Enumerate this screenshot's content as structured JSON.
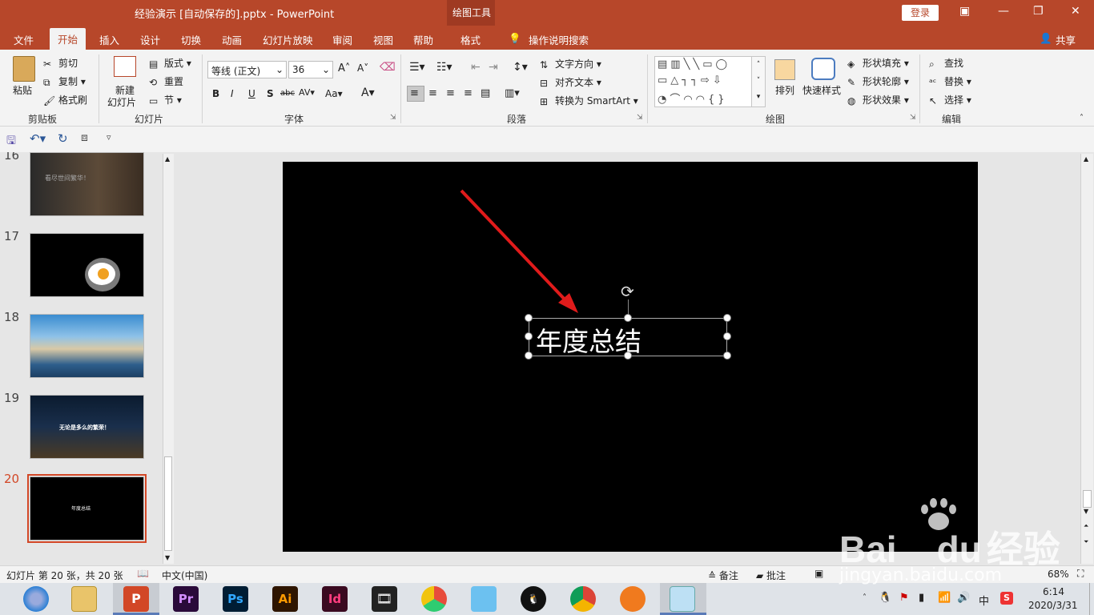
{
  "window": {
    "title": "经验演示 [自动保存的].pptx  -  PowerPoint",
    "context_tab": "绘图工具",
    "login": "登录"
  },
  "tabs": [
    "文件",
    "开始",
    "插入",
    "设计",
    "切换",
    "动画",
    "幻灯片放映",
    "审阅",
    "视图",
    "帮助",
    "格式"
  ],
  "tell_me": "操作说明搜索",
  "share": "共享",
  "ribbon": {
    "clipboard": {
      "paste": "粘贴",
      "cut": "剪切",
      "copy": "复制",
      "format_painter": "格式刷",
      "label": "剪贴板"
    },
    "slides": {
      "new_slide_1": "新建",
      "new_slide_2": "幻灯片",
      "layout": "版式",
      "reset": "重置",
      "section": "节",
      "label": "幻灯片"
    },
    "font": {
      "name": "等线 (正文)",
      "size": "36",
      "bold": "B",
      "italic": "I",
      "underline": "U",
      "shadow": "S",
      "strike": "abc",
      "spacing": "AV",
      "case": "Aa",
      "label": "字体"
    },
    "paragraph": {
      "text_direction": "文字方向",
      "align_text": "对齐文本",
      "smartart": "转换为 SmartArt",
      "label": "段落"
    },
    "drawing": {
      "arrange": "排列",
      "quick_styles": "快速样式",
      "fill": "形状填充",
      "outline": "形状轮廓",
      "effects": "形状效果",
      "label": "绘图"
    },
    "editing": {
      "find": "查找",
      "replace": "替换",
      "select": "选择",
      "label": "编辑"
    }
  },
  "thumbnails": [
    {
      "num": "16",
      "caption": "看尽世间繁华！"
    },
    {
      "num": "17",
      "caption": ""
    },
    {
      "num": "18",
      "caption": ""
    },
    {
      "num": "19",
      "caption": "无论是多么的繁荣！"
    },
    {
      "num": "20",
      "caption": "年度总结"
    }
  ],
  "slide": {
    "text": "年度总结"
  },
  "status": {
    "slide_info": "幻灯片 第 20 张，共 20 张",
    "language": "中文(中国)",
    "notes": "备注",
    "comments": "批注",
    "zoom": "68%"
  },
  "taskbar": {
    "time": "6:14",
    "date": "2020/3/31",
    "ime": "中"
  },
  "watermark": {
    "brand": "Bai",
    "brand2": "du",
    "cn": "经验",
    "url": "jingyan.baidu.com"
  },
  "colors": {
    "accent": "#b7472a",
    "context": "#9f3a22",
    "selected_thumb": "#d24726",
    "arrow": "#e01b1b"
  }
}
